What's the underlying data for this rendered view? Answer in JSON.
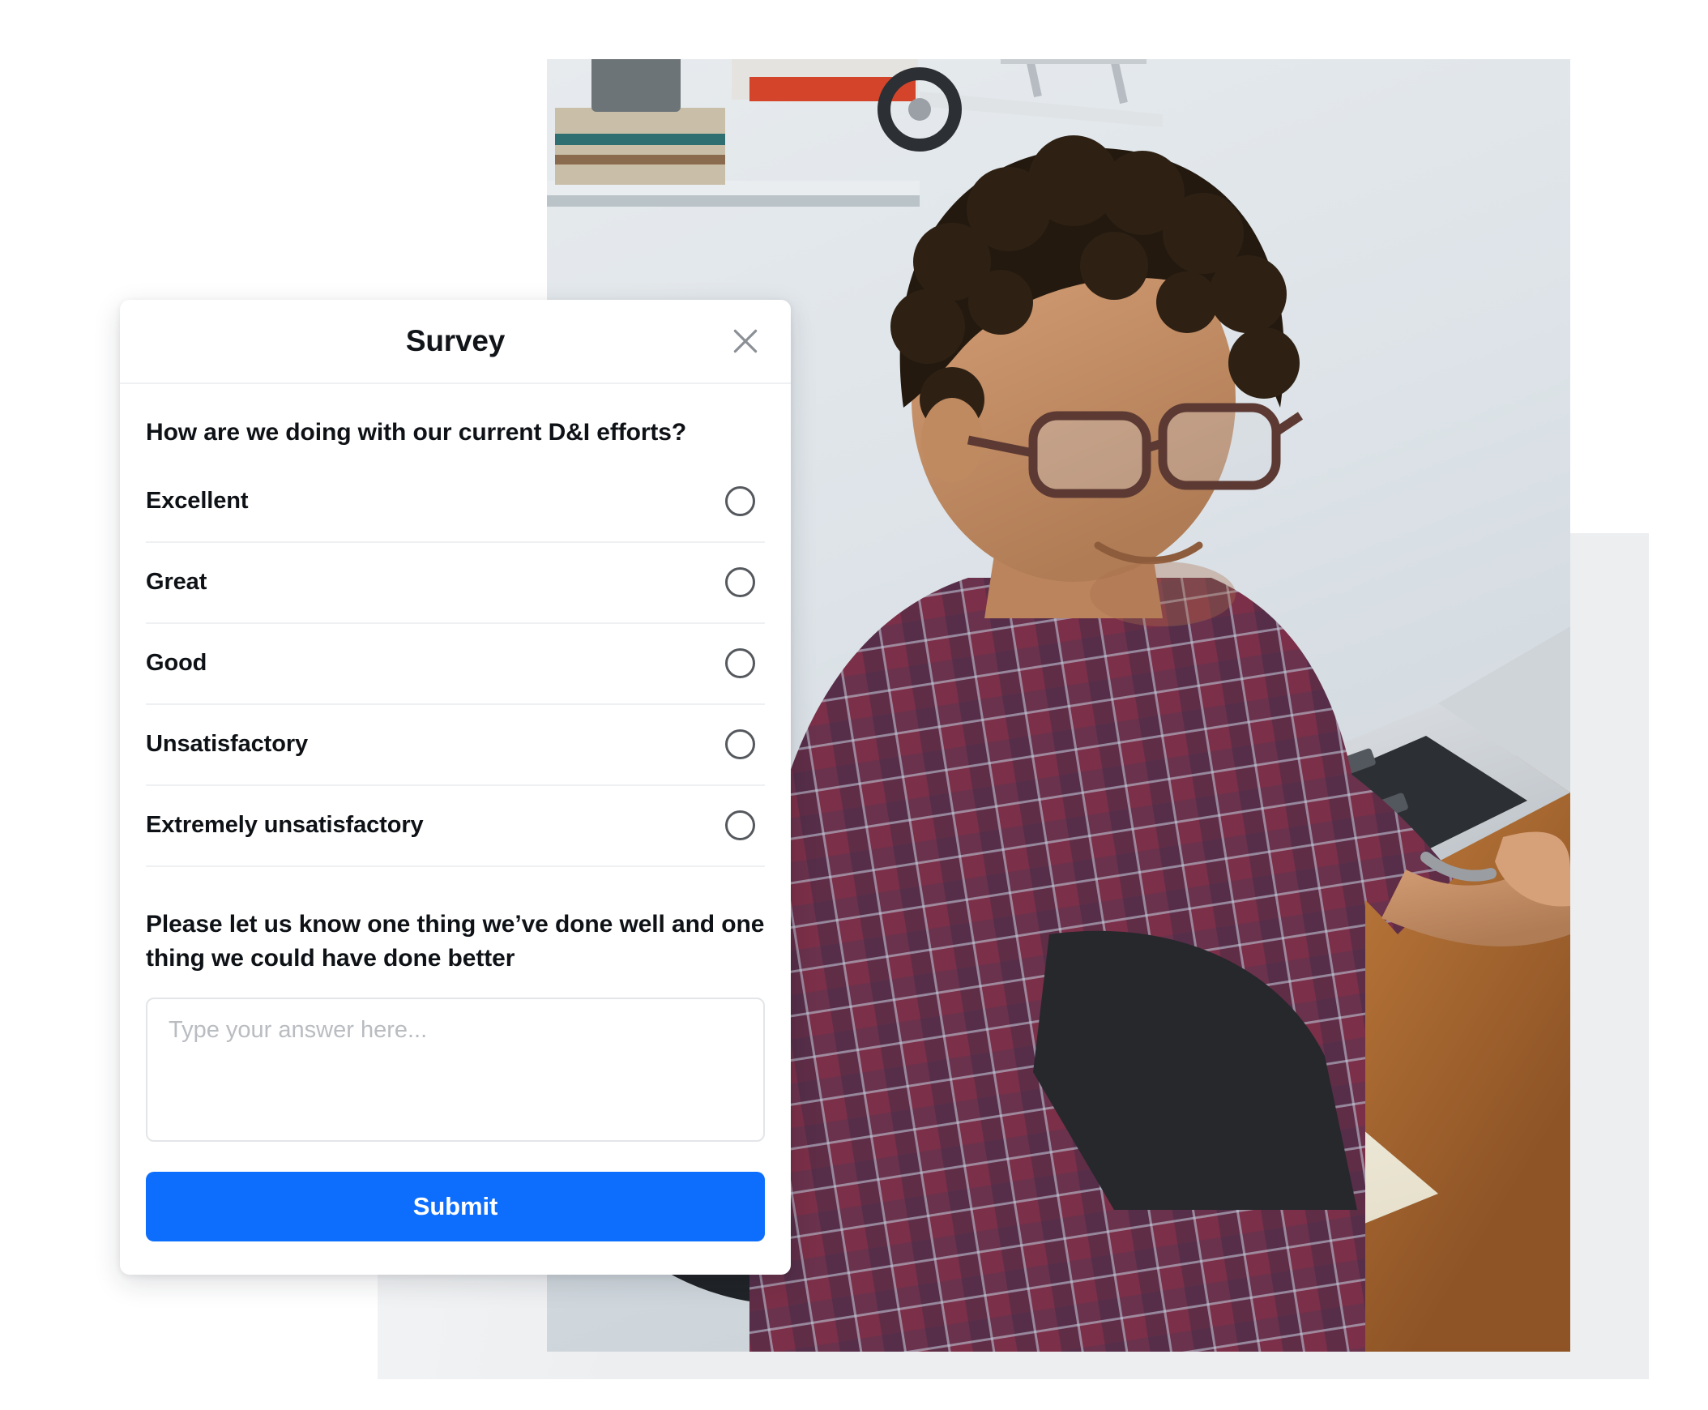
{
  "card": {
    "title": "Survey",
    "close_icon": "close-icon",
    "question": "How are we doing with our current D&I efforts?",
    "options": [
      {
        "label": "Excellent",
        "selected": false
      },
      {
        "label": "Great",
        "selected": false
      },
      {
        "label": "Good",
        "selected": false
      },
      {
        "label": "Unsatisfactory",
        "selected": false
      },
      {
        "label": "Extremely unsatisfactory",
        "selected": false
      }
    ],
    "free_text_question": "Please let us know one thing we’ve done well and one thing we could have done better",
    "answer": {
      "value": "",
      "placeholder": "Type your answer here..."
    },
    "submit_label": "Submit"
  },
  "photo": {
    "alt": "Man in a wheelchair working on a laptop at a wooden desk with an open notebook and pen"
  },
  "colors": {
    "accent": "#0d6efd",
    "card_background": "#ffffff",
    "panel_background": "#eceef0",
    "text_primary": "#0e1216",
    "divider": "#eef0f2",
    "radio_border": "#55595e",
    "placeholder": "#b9bcc0",
    "close_icon": "#8b9096"
  }
}
